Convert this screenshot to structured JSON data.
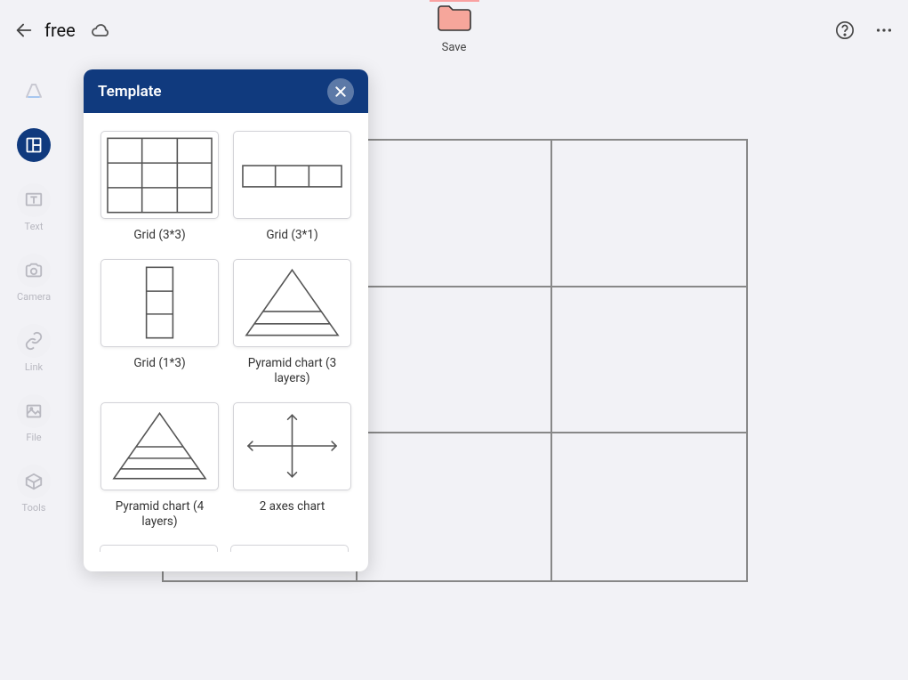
{
  "doc_title": "free",
  "save_label": "Save",
  "template_panel": {
    "title": "Template",
    "items": [
      {
        "label": "Grid (3*3)"
      },
      {
        "label": "Grid (3*1)"
      },
      {
        "label": "Grid (1*3)"
      },
      {
        "label": "Pyramid chart (3 layers)"
      },
      {
        "label": "Pyramid chart (4 layers)"
      },
      {
        "label": "2 axes chart"
      }
    ]
  },
  "sidebar": {
    "items": [
      {
        "label": ""
      },
      {
        "label": ""
      },
      {
        "label": "Text"
      },
      {
        "label": "Camera"
      },
      {
        "label": "Link"
      },
      {
        "label": "File"
      },
      {
        "label": "Tools"
      }
    ]
  }
}
